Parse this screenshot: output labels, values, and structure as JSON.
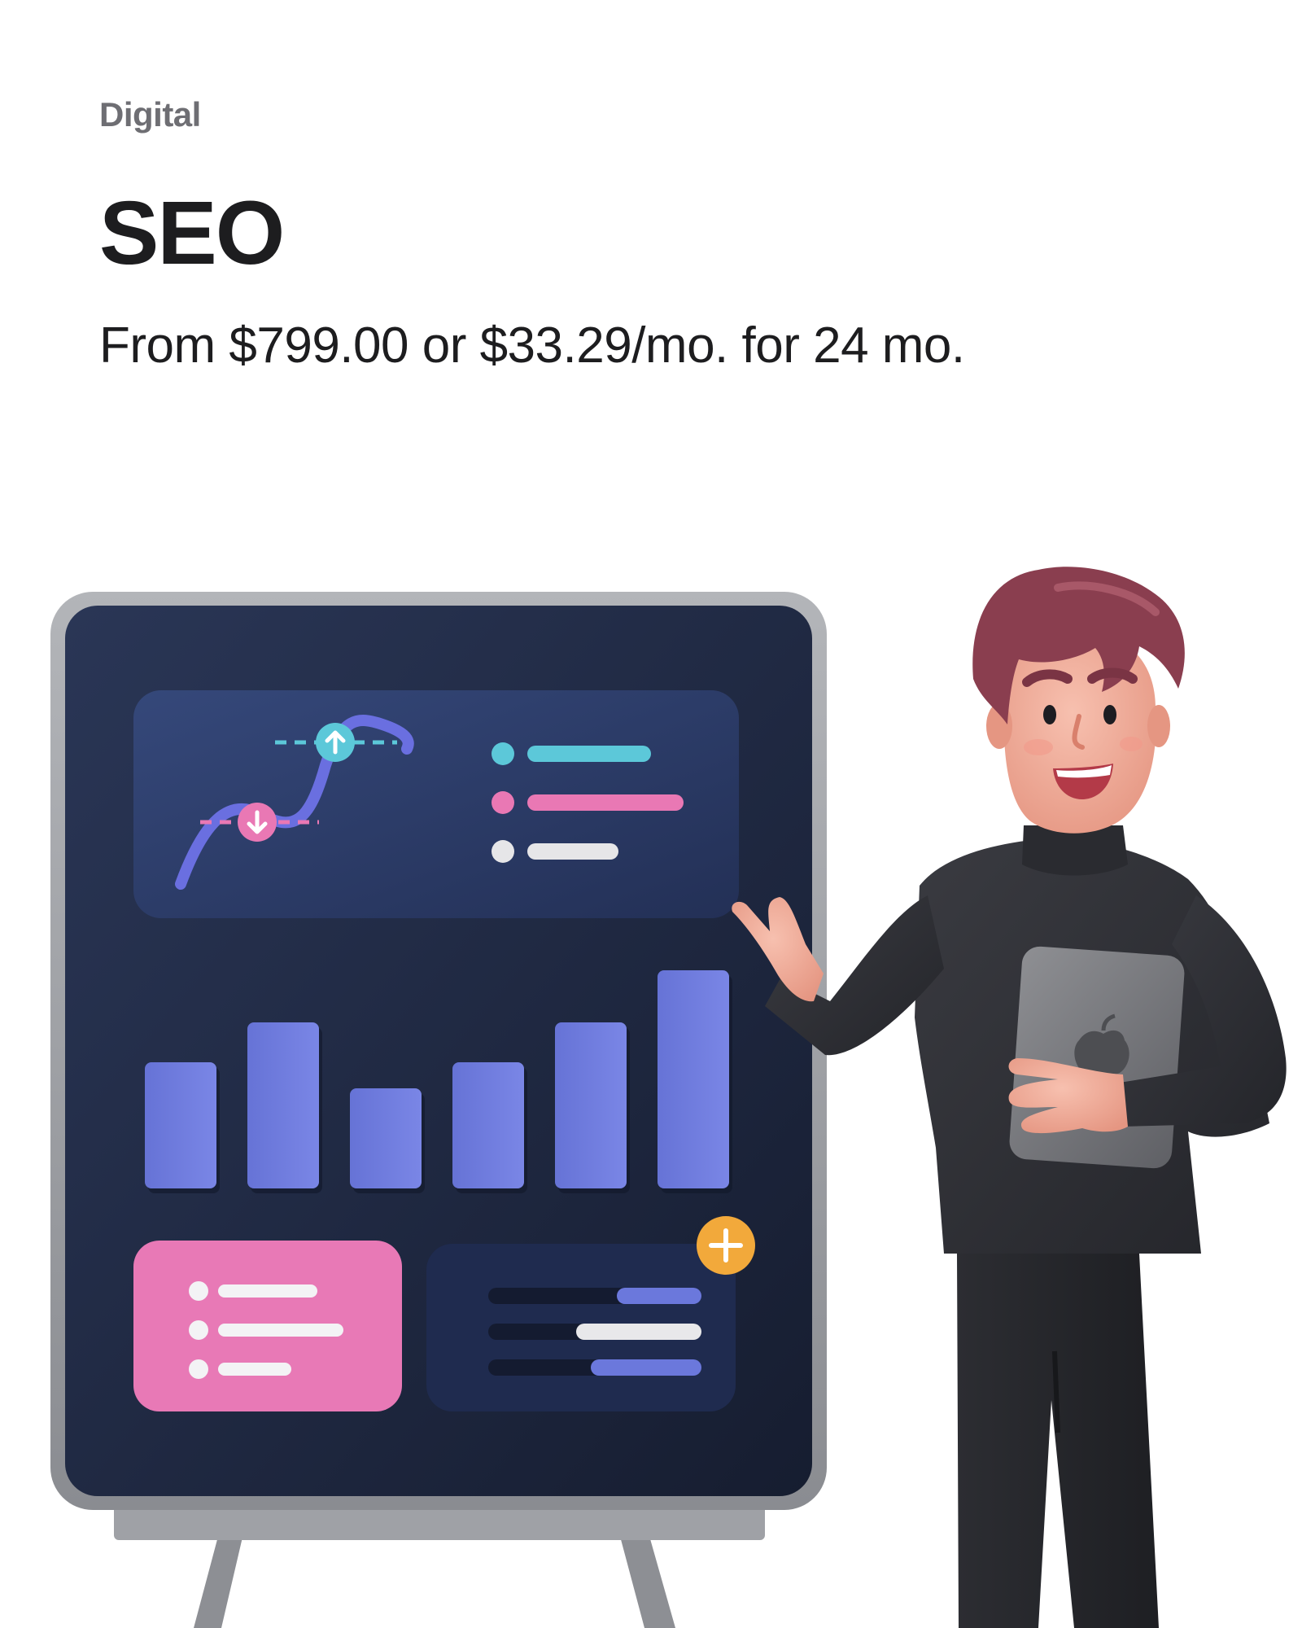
{
  "product": {
    "category": "Digital",
    "name": "SEO",
    "price_line": "From $799.00 or $33.29/mo. for 24 mo."
  },
  "illustration": {
    "subject": "presenter-with-dashboard-board",
    "board_bar_levels": [
      0.58,
      0.76,
      0.46,
      0.58,
      0.76,
      1.0
    ],
    "colors": {
      "board": "#1f2a44",
      "frame": "#9a9ca1",
      "cyan": "#5cc8d9",
      "pink": "#e978b4",
      "violet": "#6b78dc",
      "orange": "#f2a93b",
      "sweater": "#2f3035",
      "hair": "#8a3e4f",
      "skin": "#f1a896"
    },
    "icons": [
      "arrow-up-icon",
      "arrow-down-icon",
      "plus-icon",
      "apple-logo-icon"
    ]
  }
}
